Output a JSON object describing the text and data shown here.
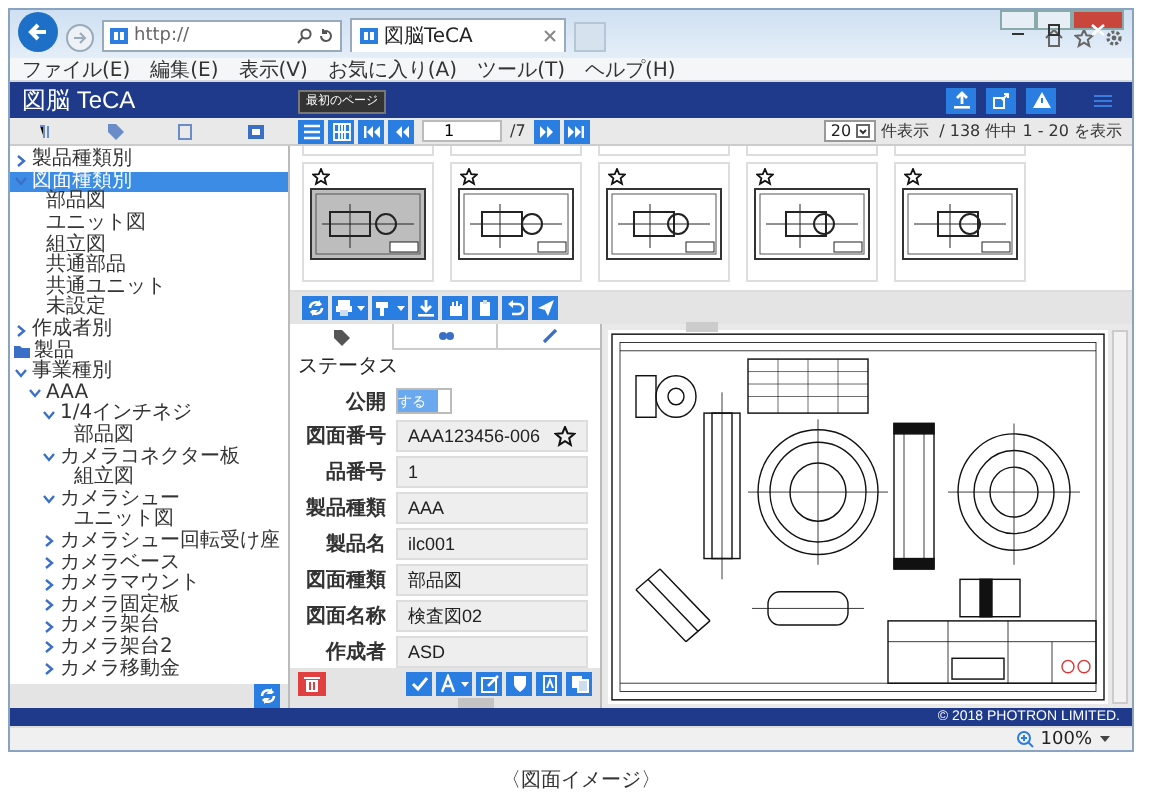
{
  "browser": {
    "address": "http://",
    "tab_title": "図脳TeCA",
    "menu": [
      "ファイル(E)",
      "編集(E)",
      "表示(V)",
      "お気に入り(A)",
      "ツール(T)",
      "ヘルプ(H)"
    ]
  },
  "app": {
    "logo": "図脳 TeCA",
    "tooltip": "最初のページ"
  },
  "pager": {
    "page": "1",
    "total": "/7",
    "per_page": "20",
    "per_page_label": "件表示",
    "summary": "/ 138 件中 1 - 20 を表示"
  },
  "tree": [
    {
      "label": "製品種類別",
      "kind": "group",
      "expanded": false,
      "selected": false
    },
    {
      "label": "図面種類別",
      "kind": "group",
      "expanded": true,
      "selected": true,
      "children": [
        {
          "label": "部品図",
          "kind": "leaf",
          "selected": false
        },
        {
          "label": "ユニット図",
          "kind": "leaf",
          "selected": false
        },
        {
          "label": "組立図",
          "kind": "leaf",
          "selected": false
        },
        {
          "label": "共通部品",
          "kind": "leaf",
          "selected": false
        },
        {
          "label": "共通ユニット",
          "kind": "leaf",
          "selected": false
        },
        {
          "label": "未設定",
          "kind": "leaf",
          "selected": false
        }
      ]
    },
    {
      "label": "作成者別",
      "kind": "group",
      "expanded": false,
      "selected": false
    },
    {
      "label": "製品",
      "kind": "folder",
      "selected": false
    },
    {
      "label": "事業種別",
      "kind": "group",
      "expanded": true,
      "selected": false,
      "children": [
        {
          "label": "AAA",
          "kind": "group",
          "expanded": true,
          "selected": false,
          "children": [
            {
              "label": "1/4インチネジ",
              "kind": "group",
              "expanded": true,
              "selected": false,
              "children": [
                {
                  "label": "部品図",
                  "kind": "leaf",
                  "selected": false
                }
              ]
            },
            {
              "label": "カメラコネクター板",
              "kind": "group",
              "expanded": true,
              "selected": false,
              "children": [
                {
                  "label": "組立図",
                  "kind": "leaf",
                  "selected": false
                }
              ]
            },
            {
              "label": "カメラシュー",
              "kind": "group",
              "expanded": true,
              "selected": false,
              "children": [
                {
                  "label": "ユニット図",
                  "kind": "leaf",
                  "selected": false
                }
              ]
            },
            {
              "label": "カメラシュー回転受け座",
              "kind": "group",
              "expanded": false,
              "selected": false
            },
            {
              "label": "カメラベース",
              "kind": "group",
              "expanded": false,
              "selected": false
            },
            {
              "label": "カメラマウント",
              "kind": "group",
              "expanded": false,
              "selected": false
            },
            {
              "label": "カメラ固定板",
              "kind": "group",
              "expanded": false,
              "selected": false
            },
            {
              "label": "カメラ架台",
              "kind": "group",
              "expanded": false,
              "selected": false
            },
            {
              "label": "カメラ架台2",
              "kind": "group",
              "expanded": false,
              "selected": false
            },
            {
              "label": "カメラ移動金",
              "kind": "group",
              "expanded": false,
              "selected": false
            }
          ]
        }
      ]
    }
  ],
  "thumbnails": [
    {
      "selected": true
    },
    {
      "selected": false
    },
    {
      "selected": false
    },
    {
      "selected": false
    },
    {
      "selected": false
    }
  ],
  "properties": {
    "tabs": [
      {
        "selected": true
      },
      {
        "selected": false
      },
      {
        "selected": false
      }
    ],
    "status_label": "ステータス",
    "publish": {
      "label": "公開",
      "toggle_text": "する",
      "on": true
    },
    "fields": [
      {
        "label": "図面番号",
        "value": "AAA123456-006",
        "kind": "favorite"
      },
      {
        "label": "品番号",
        "value": "1",
        "kind": "text"
      },
      {
        "label": "製品種類",
        "value": "AAA",
        "kind": "text"
      },
      {
        "label": "製品名",
        "value": "ilc001",
        "kind": "text"
      },
      {
        "label": "図面種類",
        "value": "部品図",
        "kind": "text"
      },
      {
        "label": "図面名称",
        "value": "検査図02",
        "kind": "text"
      },
      {
        "label": "作成者",
        "value": "ASD",
        "kind": "text"
      }
    ]
  },
  "copyright": "© 2018 PHOTRON LIMITED.",
  "zoom": "100%",
  "caption": "〈図面イメージ〉"
}
